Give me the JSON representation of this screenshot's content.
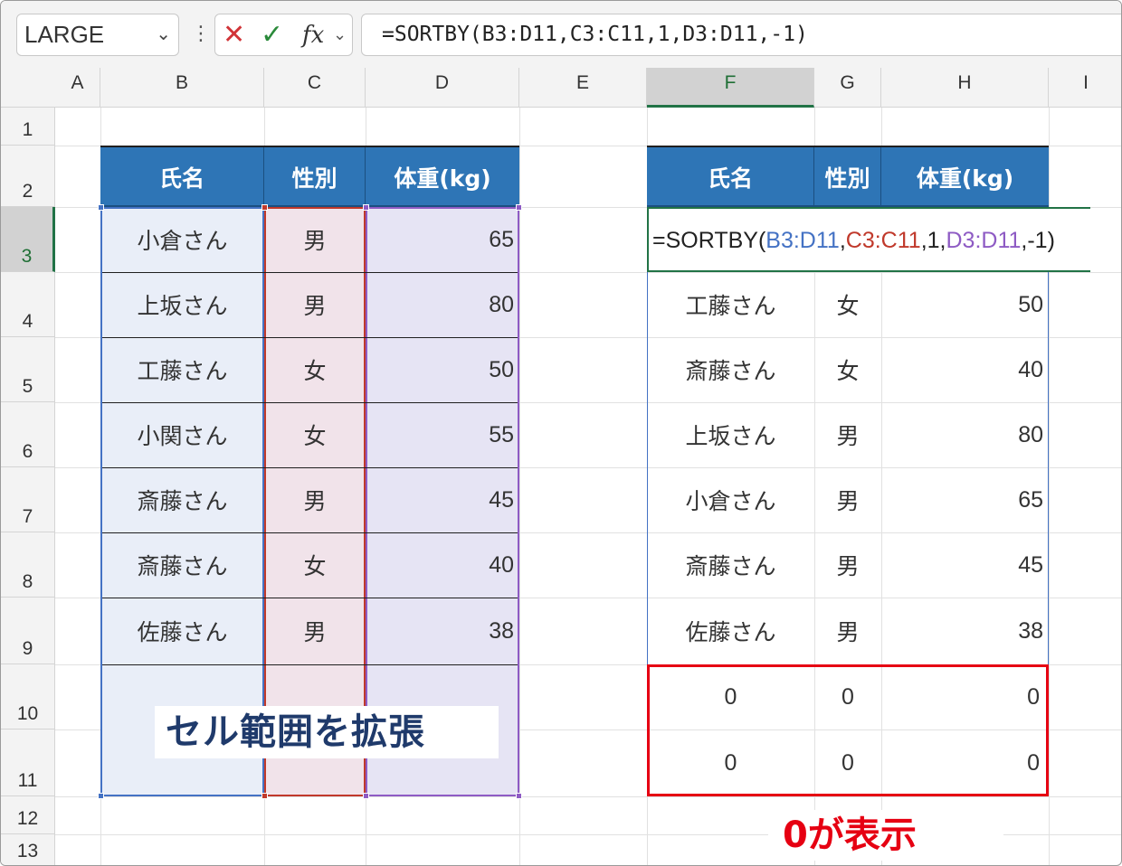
{
  "name_box": "LARGE",
  "formula_bar": {
    "formula": "=SORTBY(B3:D11,C3:C11,1,D3:D11,-1)",
    "fx_label": "fx"
  },
  "columns": [
    "A",
    "B",
    "C",
    "D",
    "E",
    "F",
    "G",
    "H",
    "I"
  ],
  "rows": [
    "1",
    "2",
    "3",
    "4",
    "5",
    "6",
    "7",
    "8",
    "9",
    "10",
    "11",
    "12",
    "13"
  ],
  "left_table": {
    "headers": [
      "氏名",
      "性別",
      "体重(kg)"
    ],
    "rows": [
      [
        "小倉さん",
        "男",
        "65"
      ],
      [
        "上坂さん",
        "男",
        "80"
      ],
      [
        "工藤さん",
        "女",
        "50"
      ],
      [
        "小関さん",
        "女",
        "55"
      ],
      [
        "斎藤さん",
        "男",
        "45"
      ],
      [
        "斎藤さん",
        "女",
        "40"
      ],
      [
        "佐藤さん",
        "男",
        "38"
      ]
    ]
  },
  "right_table": {
    "headers": [
      "氏名",
      "性別",
      "体重(kg)"
    ],
    "editing_formula": {
      "prefix": "=SORTBY(",
      "ref1": "B3:D11",
      "sep1": ",",
      "ref2": "C3:C11",
      "mid": ",1,",
      "ref3": "D3:D11",
      "suffix": ",-1)"
    },
    "rows": [
      [
        "工藤さん",
        "女",
        "50"
      ],
      [
        "斎藤さん",
        "女",
        "40"
      ],
      [
        "上坂さん",
        "男",
        "80"
      ],
      [
        "小倉さん",
        "男",
        "65"
      ],
      [
        "斎藤さん",
        "男",
        "45"
      ],
      [
        "佐藤さん",
        "男",
        "38"
      ],
      [
        "0",
        "0",
        "0"
      ],
      [
        "0",
        "0",
        "0"
      ]
    ]
  },
  "annotations": {
    "expand_range": "セル範囲を拡張",
    "zero_shown": "0が表示"
  },
  "colors": {
    "header_fill": "#2e75b6",
    "accent_red": "#e60012",
    "callout_navy": "#1f3a6b",
    "selection_green": "#217346"
  }
}
